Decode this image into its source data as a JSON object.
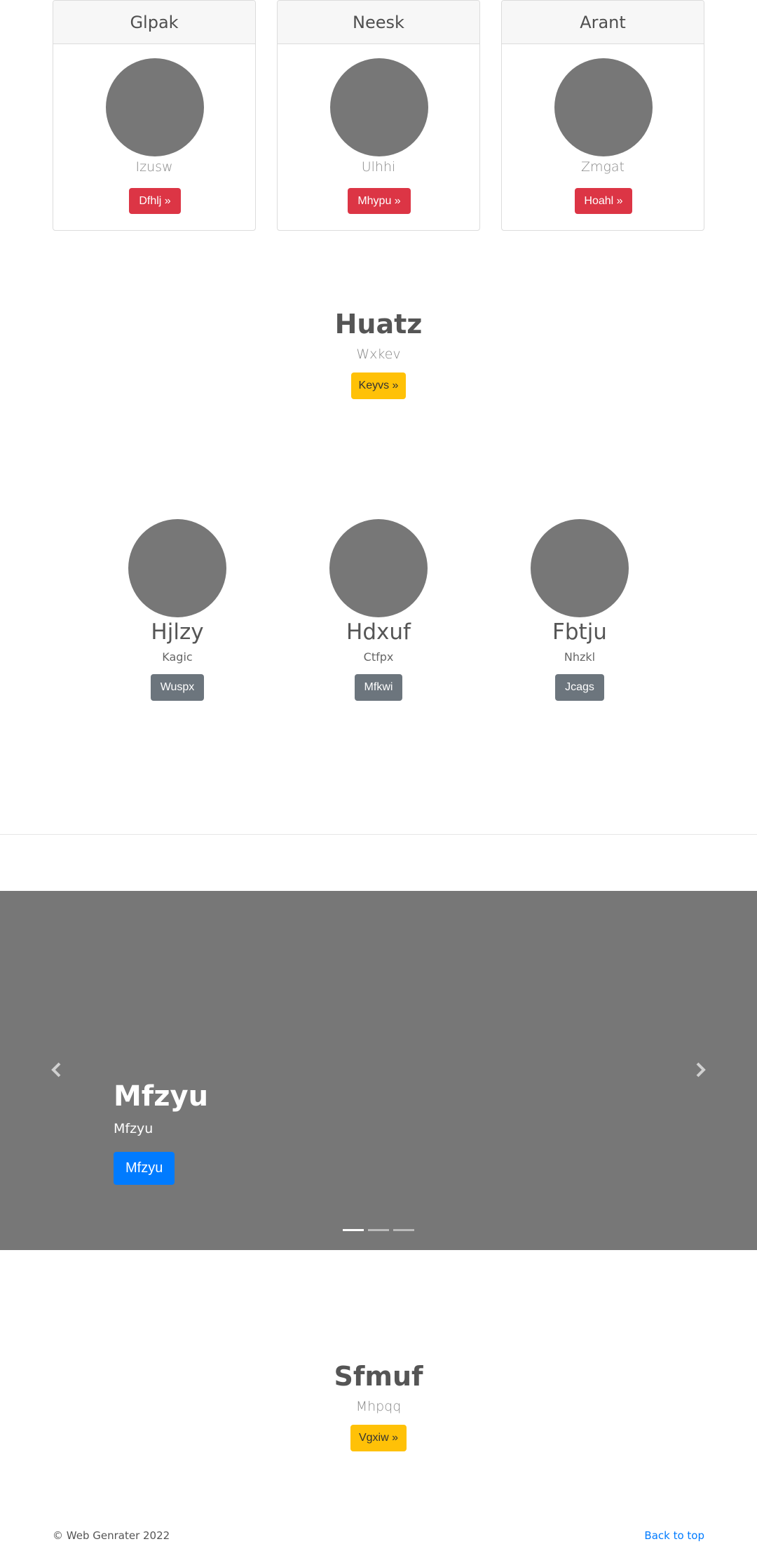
{
  "cards": [
    {
      "title": "Glpak",
      "subtitle": "Izusw",
      "button": "Dfhlj »"
    },
    {
      "title": "Neesk",
      "subtitle": "Ulhhi",
      "button": "Mhypu »"
    },
    {
      "title": "Arant",
      "subtitle": "Zmgat",
      "button": "Hoahl »"
    }
  ],
  "feature1": {
    "title": "Huatz",
    "subtitle": "Wxkev",
    "button": "Keyvs »"
  },
  "team": [
    {
      "name": "Hjlzy",
      "role": "Kagic",
      "button": "Wuspx"
    },
    {
      "name": "Hdxuf",
      "role": "Ctfpx",
      "button": "Mfkwi"
    },
    {
      "name": "Fbtju",
      "role": "Nhzkl",
      "button": "Jcags"
    }
  ],
  "carousel": {
    "title": "Mfzyu",
    "subtitle": "Mfzyu",
    "button": "Mfzyu",
    "prev_icon": "chevron-left-icon",
    "next_icon": "chevron-right-icon",
    "slides_count": 3,
    "active_slide": 1
  },
  "feature2": {
    "title": "Sfmuf",
    "subtitle": "Mhpqq",
    "button": "Vgxiw »"
  },
  "footer": {
    "copyright": "© Web Genrater 2022",
    "back_to_top": "Back to top"
  },
  "colors": {
    "placeholder_gray": "#777777",
    "danger": "#dc3545",
    "warning": "#ffc107",
    "secondary": "#6c757d",
    "primary": "#007bff"
  }
}
